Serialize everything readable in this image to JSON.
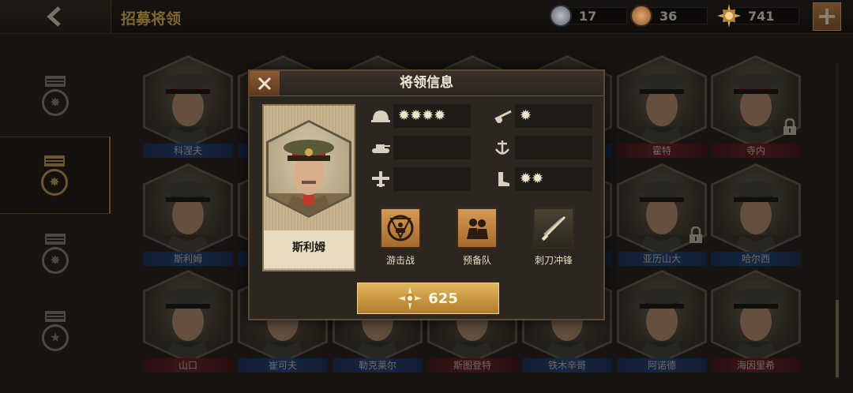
{
  "header": {
    "title": "招募将领",
    "resources": [
      {
        "icon": "silver-medal-icon",
        "value": "17"
      },
      {
        "icon": "bronze-medal-icon",
        "value": "36"
      },
      {
        "icon": "gold-star-medal-icon",
        "value": "741"
      }
    ],
    "add_label": "+"
  },
  "sidebar": {
    "tabs": [
      {
        "icon": "rank-tab-1-icon",
        "active": false
      },
      {
        "icon": "rank-tab-2-icon",
        "active": true
      },
      {
        "icon": "rank-tab-3-icon",
        "active": false
      },
      {
        "icon": "rank-tab-4-icon",
        "active": false
      }
    ]
  },
  "generals": [
    {
      "name": "科涅夫",
      "team": "blue",
      "locked": false
    },
    {
      "name": "",
      "team": "blue",
      "locked": false
    },
    {
      "name": "",
      "team": "blue",
      "locked": false
    },
    {
      "name": "",
      "team": "blue",
      "locked": false
    },
    {
      "name": "",
      "team": "blue",
      "locked": false
    },
    {
      "name": "霍特",
      "team": "red",
      "locked": false
    },
    {
      "name": "寺内",
      "team": "red",
      "locked": true
    },
    {
      "name": "斯利姆",
      "team": "blue",
      "locked": false
    },
    {
      "name": "",
      "team": "blue",
      "locked": false
    },
    {
      "name": "",
      "team": "blue",
      "locked": false
    },
    {
      "name": "",
      "team": "blue",
      "locked": false
    },
    {
      "name": "",
      "team": "blue",
      "locked": false
    },
    {
      "name": "亚历山大",
      "team": "blue",
      "locked": true
    },
    {
      "name": "哈尔西",
      "team": "blue",
      "locked": false
    },
    {
      "name": "山口",
      "team": "red",
      "locked": false
    },
    {
      "name": "崔可夫",
      "team": "blue",
      "locked": false
    },
    {
      "name": "勒克莱尔",
      "team": "blue",
      "locked": false
    },
    {
      "name": "斯图登特",
      "team": "red",
      "locked": false
    },
    {
      "name": "铁木辛哥",
      "team": "blue",
      "locked": false
    },
    {
      "name": "阿诺德",
      "team": "blue",
      "locked": false
    },
    {
      "name": "海因里希",
      "team": "red",
      "locked": false
    }
  ],
  "modal": {
    "title": "将领信息",
    "general_name": "斯利姆",
    "stats": [
      {
        "icon": "infantry-helmet-icon",
        "stars": "✹✹✹✹"
      },
      {
        "icon": "artillery-icon",
        "stars": "✹"
      },
      {
        "icon": "tank-icon",
        "stars": ""
      },
      {
        "icon": "navy-anchor-icon",
        "stars": ""
      },
      {
        "icon": "aircraft-icon",
        "stars": ""
      },
      {
        "icon": "boot-icon",
        "stars": "✹✹"
      }
    ],
    "skills": [
      {
        "icon": "guerrilla-icon",
        "label": "游击战"
      },
      {
        "icon": "reserve-troops-icon",
        "label": "预备队"
      },
      {
        "icon": "bayonet-charge-icon",
        "label": "刺刀冲锋"
      }
    ],
    "cost": "625",
    "colors": {
      "accent": "#e2b65c",
      "title": "#e6b85a"
    }
  }
}
